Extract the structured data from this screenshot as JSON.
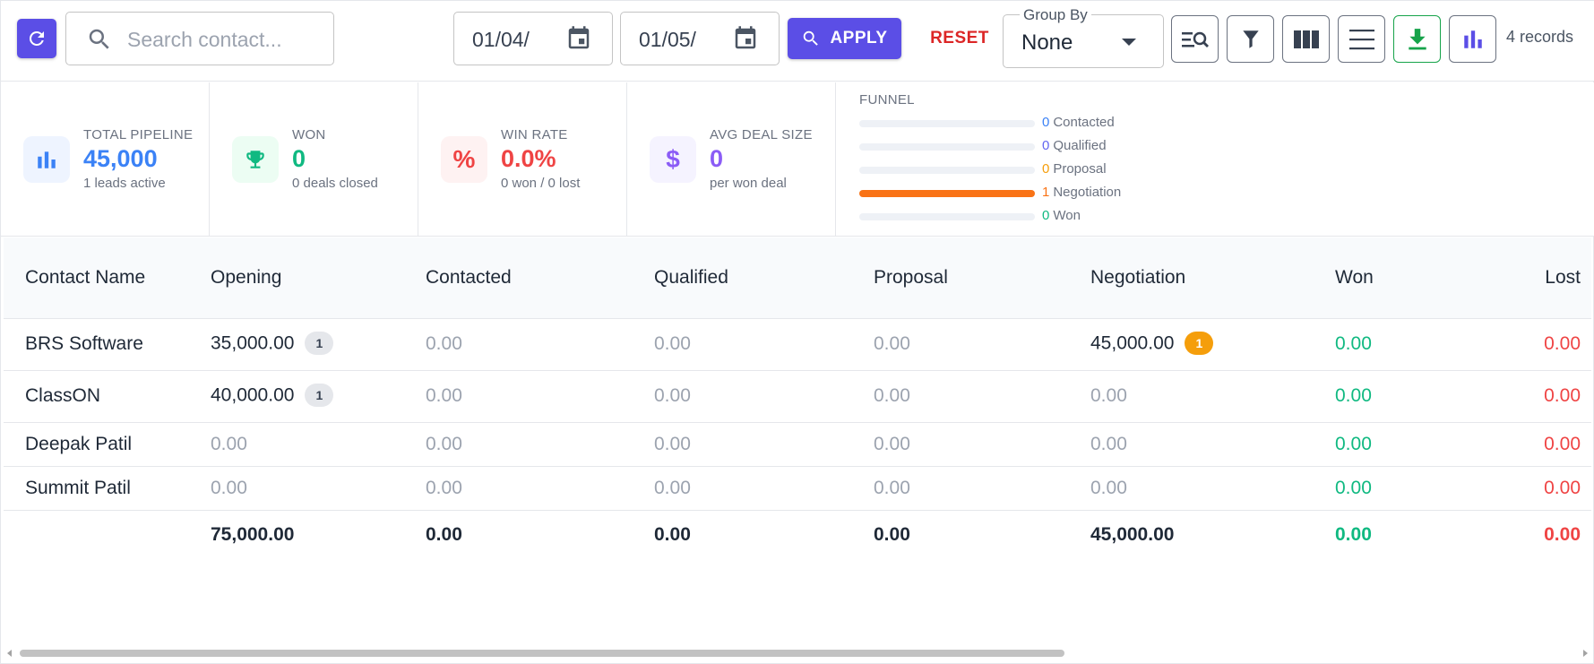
{
  "toolbar": {
    "search_placeholder": "Search contact...",
    "date_from": "01/04/",
    "date_to": "01/05/",
    "apply_label": "APPLY",
    "reset_label": "RESET",
    "group_by_label": "Group By",
    "group_by_value": "None",
    "records_text": "4 records",
    "accent_color": "#5b4ee6",
    "reset_color": "#dc2626"
  },
  "icons": {
    "refresh": "refresh-icon",
    "search": "search-icon",
    "calendar": "calendar-icon",
    "zoom_list": "search-list-icon",
    "filter": "filter-icon",
    "columns": "columns-icon",
    "density": "menu-lines-icon",
    "download": "download-icon",
    "chart": "bar-chart-icon"
  },
  "stats": {
    "total_pipeline": {
      "label": "TOTAL PIPELINE",
      "value": "45,000",
      "sub": "1 leads active",
      "color": "#3b82f6"
    },
    "won": {
      "label": "WON",
      "value": "0",
      "sub": "0 deals closed",
      "color": "#10b981"
    },
    "win_rate": {
      "label": "WIN RATE",
      "value": "0.0%",
      "sub": "0 won / 0 lost",
      "color": "#ef4444"
    },
    "avg_deal": {
      "label": "AVG DEAL SIZE",
      "value": "0",
      "sub": "per won deal",
      "color": "#8b5cf6"
    }
  },
  "funnel": {
    "title": "FUNNEL",
    "stages": [
      {
        "count": "0",
        "label": "Contacted",
        "count_color": "#3b82f6",
        "fill": 0
      },
      {
        "count": "0",
        "label": "Qualified",
        "count_color": "#6366f1",
        "fill": 0
      },
      {
        "count": "0",
        "label": "Proposal",
        "count_color": "#f59e0b",
        "fill": 0
      },
      {
        "count": "1",
        "label": "Negotiation",
        "count_color": "#f97316",
        "fill": 1
      },
      {
        "count": "0",
        "label": "Won",
        "count_color": "#10b981",
        "fill": 0
      }
    ]
  },
  "table": {
    "headers": [
      "Contact Name",
      "Opening",
      "Contacted",
      "Qualified",
      "Proposal",
      "Negotiation",
      "Won",
      "Lost"
    ],
    "rows": [
      {
        "name": "BRS Software",
        "opening": "35,000.00",
        "opening_badge": "1",
        "contacted": "0.00",
        "qualified": "0.00",
        "proposal": "0.00",
        "negotiation": "45,000.00",
        "negotiation_badge": "1",
        "won": "0.00",
        "lost": "0.00"
      },
      {
        "name": "ClassON",
        "opening": "40,000.00",
        "opening_badge": "1",
        "contacted": "0.00",
        "qualified": "0.00",
        "proposal": "0.00",
        "negotiation": "0.00",
        "won": "0.00",
        "lost": "0.00"
      },
      {
        "name": "Deepak Patil",
        "opening": "0.00",
        "contacted": "0.00",
        "qualified": "0.00",
        "proposal": "0.00",
        "negotiation": "0.00",
        "won": "0.00",
        "lost": "0.00"
      },
      {
        "name": "Summit Patil",
        "opening": "0.00",
        "contacted": "0.00",
        "qualified": "0.00",
        "proposal": "0.00",
        "negotiation": "0.00",
        "won": "0.00",
        "lost": "0.00"
      }
    ],
    "totals": {
      "opening": "75,000.00",
      "contacted": "0.00",
      "qualified": "0.00",
      "proposal": "0.00",
      "negotiation": "45,000.00",
      "won": "0.00",
      "lost": "0.00"
    }
  }
}
